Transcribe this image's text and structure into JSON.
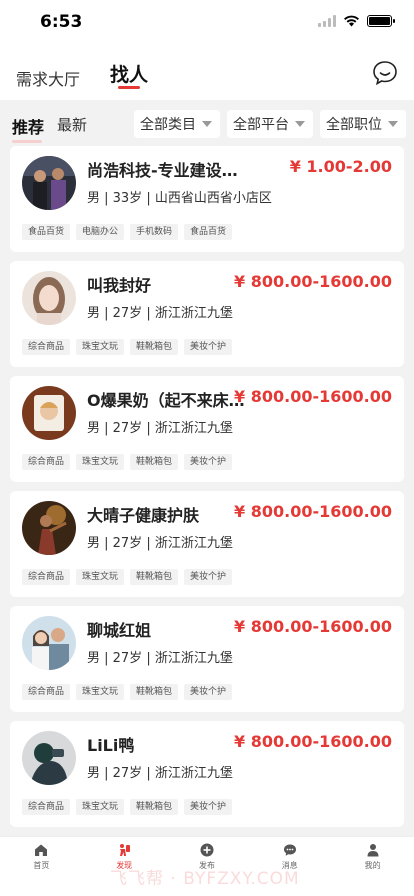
{
  "status": {
    "time": "6:53"
  },
  "tabs": [
    "需求大厅",
    "找人"
  ],
  "sort": [
    "推荐",
    "最新"
  ],
  "filters": [
    "全部类目",
    "全部平台",
    "全部职位"
  ],
  "cards": [
    {
      "name": "尚浩科技-专业建设网站",
      "price": "¥ 1.00-2.00",
      "info": "男 | 33岁 | 山西省山西省小店区",
      "tags": [
        "食品百货",
        "电脑办公",
        "手机数码",
        "食品百货"
      ]
    },
    {
      "name": "叫我封好",
      "price": "¥ 800.00-1600.00",
      "info": "男 | 27岁 | 浙江浙江九堡",
      "tags": [
        "综合商品",
        "珠宝文玩",
        "鞋靴箱包",
        "美妆个护"
      ]
    },
    {
      "name": "O爆果奶（起不来床版）",
      "price": "¥ 800.00-1600.00",
      "info": "男 | 27岁 | 浙江浙江九堡",
      "tags": [
        "综合商品",
        "珠宝文玩",
        "鞋靴箱包",
        "美妆个护"
      ]
    },
    {
      "name": "大晴子健康护肤",
      "price": "¥ 800.00-1600.00",
      "info": "男 | 27岁 | 浙江浙江九堡",
      "tags": [
        "综合商品",
        "珠宝文玩",
        "鞋靴箱包",
        "美妆个护"
      ]
    },
    {
      "name": "聊城红姐",
      "price": "¥ 800.00-1600.00",
      "info": "男 | 27岁 | 浙江浙江九堡",
      "tags": [
        "综合商品",
        "珠宝文玩",
        "鞋靴箱包",
        "美妆个护"
      ]
    },
    {
      "name": "LiLi鸭",
      "price": "¥ 800.00-1600.00",
      "info": "男 | 27岁 | 浙江浙江九堡",
      "tags": [
        "综合商品",
        "珠宝文玩",
        "鞋靴箱包",
        "美妆个护"
      ]
    }
  ],
  "nav": [
    {
      "label": "首页",
      "icon": "home-icon"
    },
    {
      "label": "发现",
      "icon": "discover-icon"
    },
    {
      "label": "发布",
      "icon": "publish-icon"
    },
    {
      "label": "消息",
      "icon": "message-icon"
    },
    {
      "label": "我的",
      "icon": "profile-icon"
    }
  ],
  "watermark": "飞飞帮 · BYFZXY.COM",
  "colors": {
    "accent": "#e53935",
    "background": "#f2f2f2"
  }
}
